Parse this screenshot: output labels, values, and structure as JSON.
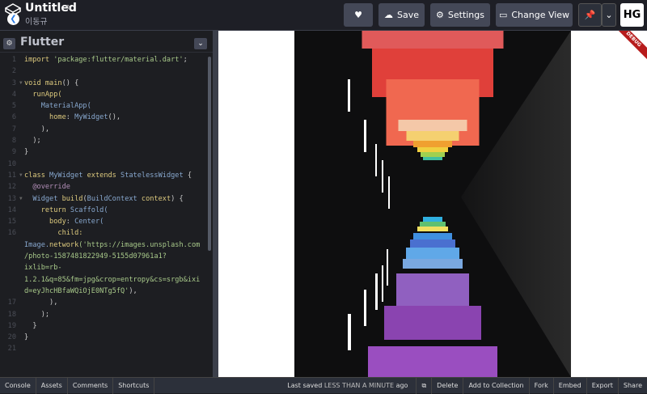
{
  "header": {
    "title": "Untitled",
    "user": "이동규",
    "buttons": {
      "save": "Save",
      "settings": "Settings",
      "change_view": "Change View"
    },
    "profile_initials": "HG"
  },
  "editor": {
    "language": "Flutter",
    "lines": [
      [
        [
          "import ",
          "k"
        ],
        [
          "'package:flutter/material.dart'",
          "s"
        ],
        [
          ";",
          "p"
        ]
      ],
      [],
      [
        [
          "void ",
          "k"
        ],
        [
          "main",
          "k"
        ],
        [
          "() {",
          "p"
        ]
      ],
      [
        [
          "  runApp(",
          "k"
        ]
      ],
      [
        [
          "    MaterialApp(",
          "t"
        ]
      ],
      [
        [
          "      home",
          "k"
        ],
        [
          ": ",
          "p"
        ],
        [
          "MyWidget",
          "t"
        ],
        [
          "(),",
          "p"
        ]
      ],
      [
        [
          "    ),",
          "p"
        ]
      ],
      [
        [
          "  );",
          "p"
        ]
      ],
      [
        [
          "}",
          "p"
        ]
      ],
      [],
      [
        [
          "class ",
          "k"
        ],
        [
          "MyWidget ",
          "t"
        ],
        [
          "extends ",
          "k"
        ],
        [
          "StatelessWidget ",
          "t"
        ],
        [
          "{",
          "p"
        ]
      ],
      [
        [
          "  @override",
          "a"
        ]
      ],
      [
        [
          "  Widget ",
          "t"
        ],
        [
          "build",
          "k"
        ],
        [
          "(",
          "p"
        ],
        [
          "BuildContext ",
          "t"
        ],
        [
          "context",
          "k"
        ],
        [
          ") {",
          "p"
        ]
      ],
      [
        [
          "    return ",
          "k"
        ],
        [
          "Scaffold(",
          "t"
        ]
      ],
      [
        [
          "      body",
          "k"
        ],
        [
          ": ",
          "p"
        ],
        [
          "Center(",
          "t"
        ]
      ],
      [
        [
          "        child:",
          "k"
        ]
      ],
      [
        [
          "Image.",
          "t"
        ],
        [
          "network",
          "k"
        ],
        [
          "('https://images.unsplash.com",
          "s"
        ]
      ],
      [
        [
          "/photo-1587481822949-5155d07961a1?",
          "s"
        ]
      ],
      [
        [
          "ixlib=rb-",
          "s"
        ]
      ],
      [
        [
          "1.2.1&q=85&fm=jpg&crop=entropy&cs=srgb&ixi",
          "s"
        ]
      ],
      [
        [
          "d=eyJhcHBfaWQiOjE0NTg5fQ'",
          "s"
        ],
        [
          "),",
          "p"
        ]
      ],
      [
        [
          "      ),",
          "p"
        ]
      ],
      [
        [
          "    );",
          "p"
        ]
      ],
      [
        [
          "  }",
          "p"
        ]
      ],
      [
        [
          "}",
          "p"
        ]
      ],
      []
    ],
    "line_numbers": [
      "1",
      "2",
      "3",
      "4",
      "5",
      "6",
      "7",
      "8",
      "9",
      "10",
      "11",
      "12",
      "13",
      "14",
      "15",
      "16",
      "",
      "",
      "",
      "",
      "",
      "17",
      "18",
      "19",
      "20",
      "21"
    ],
    "folds": [
      2,
      10,
      12
    ]
  },
  "preview": {
    "badge": "DEBUG"
  },
  "footer": {
    "left": [
      "Console",
      "Assets",
      "Comments",
      "Shortcuts"
    ],
    "saved_prefix": "Last saved",
    "saved_time": "LESS THAN A MINUTE",
    "saved_suffix": "ago",
    "right": [
      "Delete",
      "Add to Collection",
      "Fork",
      "Embed",
      "Export",
      "Share"
    ]
  }
}
